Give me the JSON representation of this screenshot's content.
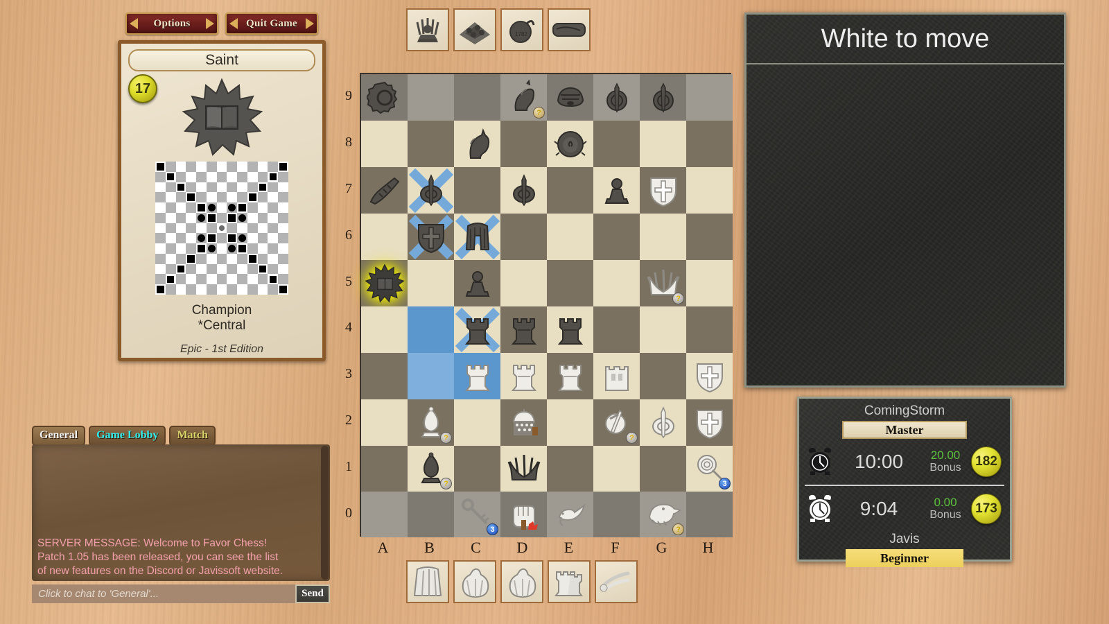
{
  "toolbar": {
    "options_label": "Options",
    "quit_label": "Quit Game"
  },
  "card": {
    "title": "Saint",
    "cost": "17",
    "name_line1": "Champion",
    "name_line2": "*Central",
    "edition": "Epic - 1st Edition",
    "emblem_icon": "book-starburst-icon"
  },
  "chat": {
    "tabs": [
      {
        "label": "General",
        "active": true
      },
      {
        "label": "Game Lobby",
        "active": false
      },
      {
        "label": "Match",
        "active": false
      }
    ],
    "messages": [
      "SERVER MESSAGE: Welcome to Favor Chess!",
      "Patch 1.05 has been released, you can see the list",
      "of new features on the Discord or Javissoft website."
    ],
    "input_placeholder": "Click to chat to 'General'...",
    "input_value": "",
    "send_label": "Send"
  },
  "status": {
    "turn_text": "White to move"
  },
  "clocks": {
    "top_player": "ComingStorm",
    "top_rank": "Master",
    "top_time": "10:00",
    "top_bonus_value": "20.00",
    "top_bonus_label": "Bonus",
    "top_score": "182",
    "bottom_time": "9:04",
    "bottom_bonus_value": "0.00",
    "bottom_bonus_label": "Bonus",
    "bottom_score": "173",
    "bottom_player": "Javis",
    "bottom_rank": "Beginner"
  },
  "board": {
    "files": [
      "A",
      "B",
      "C",
      "D",
      "E",
      "F",
      "G",
      "H"
    ],
    "ranks": [
      "9",
      "8",
      "7",
      "6",
      "5",
      "4",
      "3",
      "2",
      "1",
      "0"
    ],
    "tray_top": [
      "black-crown-piece",
      "black-board-stack",
      "black-bomb",
      "black-scroll"
    ],
    "tray_bottom": [
      "white-cloak",
      "white-sack",
      "white-sack",
      "white-rooks",
      "white-bones"
    ]
  },
  "card_grid": {
    "note": "13x13 movement diagram for Champion *Central",
    "marks": [
      {
        "r": 0,
        "c": 0,
        "k": "sq"
      },
      {
        "r": 0,
        "c": 12,
        "k": "sq"
      },
      {
        "r": 1,
        "c": 1,
        "k": "sq"
      },
      {
        "r": 1,
        "c": 11,
        "k": "sq"
      },
      {
        "r": 2,
        "c": 2,
        "k": "sq"
      },
      {
        "r": 2,
        "c": 10,
        "k": "sq"
      },
      {
        "r": 3,
        "c": 3,
        "k": "sq"
      },
      {
        "r": 3,
        "c": 9,
        "k": "sq"
      },
      {
        "r": 4,
        "c": 4,
        "k": "sq"
      },
      {
        "r": 4,
        "c": 5,
        "k": "ci"
      },
      {
        "r": 4,
        "c": 7,
        "k": "ci"
      },
      {
        "r": 4,
        "c": 8,
        "k": "sq"
      },
      {
        "r": 5,
        "c": 4,
        "k": "ci"
      },
      {
        "r": 5,
        "c": 5,
        "k": "sq"
      },
      {
        "r": 5,
        "c": 7,
        "k": "sq"
      },
      {
        "r": 5,
        "c": 8,
        "k": "ci"
      },
      {
        "r": 6,
        "c": 6,
        "k": "ce"
      },
      {
        "r": 7,
        "c": 4,
        "k": "ci"
      },
      {
        "r": 7,
        "c": 5,
        "k": "sq"
      },
      {
        "r": 7,
        "c": 7,
        "k": "sq"
      },
      {
        "r": 7,
        "c": 8,
        "k": "ci"
      },
      {
        "r": 8,
        "c": 4,
        "k": "sq"
      },
      {
        "r": 8,
        "c": 5,
        "k": "ci"
      },
      {
        "r": 8,
        "c": 7,
        "k": "ci"
      },
      {
        "r": 8,
        "c": 8,
        "k": "sq"
      },
      {
        "r": 9,
        "c": 3,
        "k": "sq"
      },
      {
        "r": 9,
        "c": 9,
        "k": "sq"
      },
      {
        "r": 10,
        "c": 2,
        "k": "sq"
      },
      {
        "r": 10,
        "c": 10,
        "k": "sq"
      },
      {
        "r": 11,
        "c": 1,
        "k": "sq"
      },
      {
        "r": 11,
        "c": 11,
        "k": "sq"
      },
      {
        "r": 12,
        "c": 0,
        "k": "sq"
      },
      {
        "r": 12,
        "c": 12,
        "k": "sq"
      }
    ]
  },
  "chart_data": {
    "type": "table",
    "title": "Favor Chess board position",
    "note": "10 ranks (9..0) x 8 files (A..H); rank 9 and rank 0 are special reserve rows",
    "pieces": [
      {
        "square": "A9",
        "side": "black",
        "piece": "gear-icon"
      },
      {
        "square": "D9",
        "side": "black",
        "piece": "unicorn-knight",
        "badge": "gold"
      },
      {
        "square": "E9",
        "side": "black",
        "piece": "helm"
      },
      {
        "square": "F9",
        "side": "black",
        "piece": "sword-shield"
      },
      {
        "square": "G9",
        "side": "black",
        "piece": "sword-shield"
      },
      {
        "square": "C8",
        "side": "black",
        "piece": "knight"
      },
      {
        "square": "E8",
        "side": "black",
        "piece": "lion"
      },
      {
        "square": "A7",
        "side": "black",
        "piece": "gauntlet"
      },
      {
        "square": "B7",
        "side": "black",
        "piece": "spear-shield",
        "highlight": "x"
      },
      {
        "square": "D7",
        "side": "black",
        "piece": "spear-shield"
      },
      {
        "square": "F7",
        "side": "black",
        "piece": "pawn"
      },
      {
        "square": "G7",
        "side": "white",
        "piece": "cross-shield"
      },
      {
        "square": "B6",
        "side": "black",
        "piece": "cross-shield",
        "highlight": "x"
      },
      {
        "square": "C6",
        "side": "black",
        "piece": "pharaoh",
        "highlight": "x"
      },
      {
        "square": "A5",
        "side": "black",
        "piece": "book-starburst",
        "selected": true
      },
      {
        "square": "C5",
        "side": "black",
        "piece": "pawn"
      },
      {
        "square": "G5",
        "side": "white",
        "piece": "crown",
        "badge": "gray"
      },
      {
        "square": "B4",
        "side": "none",
        "piece": "",
        "highlight": "fill"
      },
      {
        "square": "C4",
        "side": "black",
        "piece": "rook",
        "highlight": "x"
      },
      {
        "square": "D4",
        "side": "black",
        "piece": "rook"
      },
      {
        "square": "E4",
        "side": "black",
        "piece": "rook"
      },
      {
        "square": "B3",
        "side": "none",
        "piece": "",
        "highlight": "fill-light"
      },
      {
        "square": "C3",
        "side": "white",
        "piece": "rook",
        "highlight": "fill"
      },
      {
        "square": "D3",
        "side": "white",
        "piece": "rook"
      },
      {
        "square": "E3",
        "side": "white",
        "piece": "rook"
      },
      {
        "square": "F3",
        "side": "white",
        "piece": "tower"
      },
      {
        "square": "H3",
        "side": "white",
        "piece": "cross-shield"
      },
      {
        "square": "B2",
        "side": "white",
        "piece": "bishop",
        "badge": "gray"
      },
      {
        "square": "D2",
        "side": "white",
        "piece": "chainmail-helm"
      },
      {
        "square": "F2",
        "side": "white",
        "piece": "dagger-shield",
        "badge": "gray"
      },
      {
        "square": "G2",
        "side": "white",
        "piece": "spear-shield"
      },
      {
        "square": "H2",
        "side": "white",
        "piece": "cross-shield"
      },
      {
        "square": "B1",
        "side": "black",
        "piece": "bishop",
        "badge": "gray"
      },
      {
        "square": "D1",
        "side": "black",
        "piece": "crown"
      },
      {
        "square": "H1",
        "side": "white",
        "piece": "rose",
        "badge": "blue"
      },
      {
        "square": "C0",
        "side": "white",
        "piece": "key",
        "badge": "blue"
      },
      {
        "square": "D0",
        "side": "white",
        "piece": "fist"
      },
      {
        "square": "E0",
        "side": "white",
        "piece": "dove"
      },
      {
        "square": "G0",
        "side": "white",
        "piece": "eagle",
        "badge": "gold"
      }
    ]
  }
}
